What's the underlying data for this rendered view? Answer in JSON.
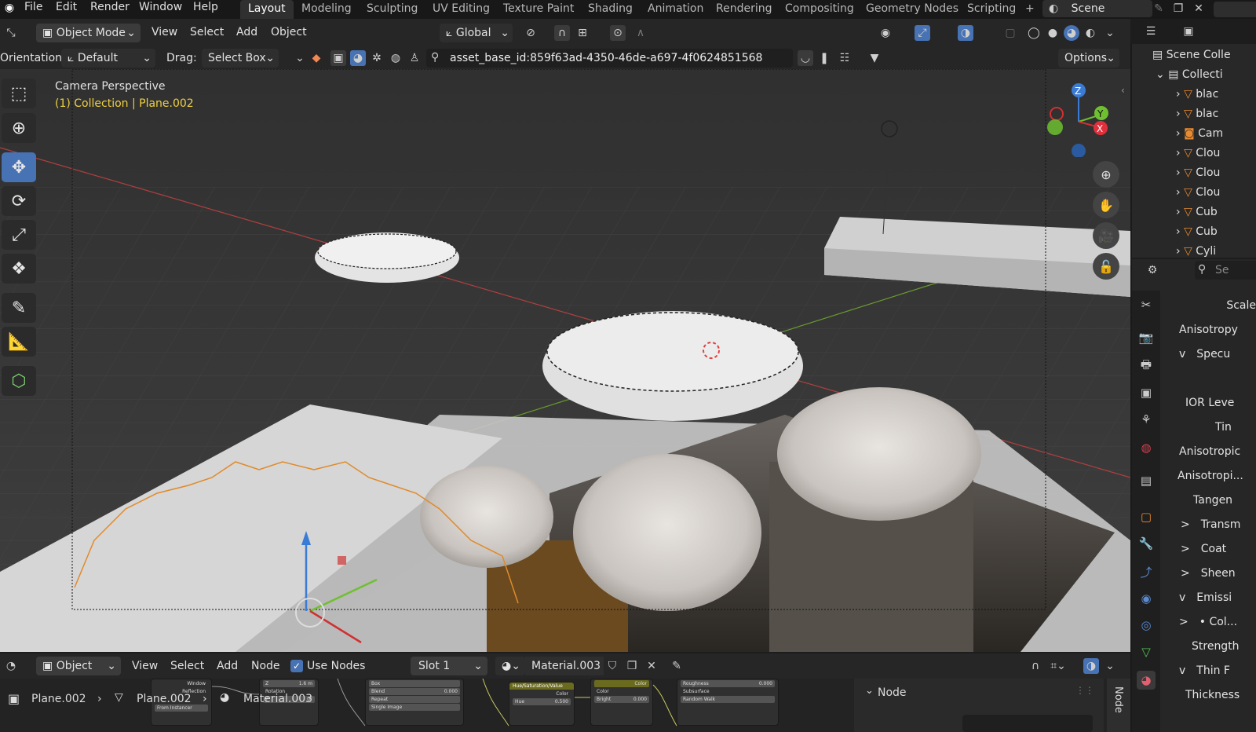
{
  "menu": {
    "items": [
      "File",
      "Edit",
      "Render",
      "Window",
      "Help"
    ]
  },
  "workspaces": {
    "active": "Layout",
    "tabs": [
      "Modeling",
      "Sculpting",
      "UV Editing",
      "Texture Paint",
      "Shading",
      "Animation",
      "Rendering",
      "Compositing",
      "Geometry Nodes",
      "Scripting"
    ]
  },
  "scene": {
    "label": "Scene",
    "add": "+"
  },
  "viewport_header": {
    "mode": "Object Mode",
    "menus": [
      "View",
      "Select",
      "Add",
      "Object"
    ],
    "transform": "Global"
  },
  "tool_header": {
    "orientation_label": "Orientation:",
    "orientation_value": "Default",
    "drag_label": "Drag:",
    "drag_value": "Select Box",
    "search_value": "asset_base_id:859f63ad-4350-46de-a697-4f0624851568",
    "options": "Options"
  },
  "viewport": {
    "camera_title": "Camera Perspective",
    "collection_info": "(1) Collection | Plane.002"
  },
  "gizmo": {
    "z": "Z",
    "y": "Y",
    "x": "X"
  },
  "outliner": {
    "scene_collection": "Scene Colle",
    "collection": "Collecti",
    "items": [
      {
        "label": "blac",
        "icon": "mesh-icon"
      },
      {
        "label": "blac",
        "icon": "mesh-icon"
      },
      {
        "label": "Cam",
        "icon": "camera-icon"
      },
      {
        "label": "Clou",
        "icon": "mesh-icon"
      },
      {
        "label": "Clou",
        "icon": "mesh-icon"
      },
      {
        "label": "Clou",
        "icon": "mesh-icon"
      },
      {
        "label": "Cub",
        "icon": "mesh-icon"
      },
      {
        "label": "Cub",
        "icon": "mesh-icon"
      },
      {
        "label": "Cyli",
        "icon": "mesh-icon"
      }
    ]
  },
  "properties": {
    "search_placeholder": "Se",
    "rows": [
      {
        "label": "Scale",
        "arrow": ""
      },
      {
        "label": "Anisotropy",
        "arrow": ""
      },
      {
        "label": "Specu",
        "arrow": "v"
      },
      {
        "label": "IOR Leve",
        "arrow": ""
      },
      {
        "label": "Tin",
        "arrow": ""
      },
      {
        "label": "Anisotropic",
        "arrow": ""
      },
      {
        "label": "Anisotropi...",
        "arrow": ""
      },
      {
        "label": "Tangen",
        "arrow": ""
      },
      {
        "label": "Transm",
        "arrow": ">"
      },
      {
        "label": "Coat",
        "arrow": ">"
      },
      {
        "label": "Sheen",
        "arrow": ">"
      },
      {
        "label": "Emissi",
        "arrow": "v"
      },
      {
        "label": "• Col...",
        "arrow": ">"
      },
      {
        "label": "Strength",
        "arrow": ""
      },
      {
        "label": "Thin F",
        "arrow": "v"
      },
      {
        "label": "Thickness",
        "arrow": ""
      }
    ]
  },
  "node_header": {
    "editor_type": "Object",
    "menus": [
      "View",
      "Select",
      "Add",
      "Node"
    ],
    "use_nodes": "Use Nodes",
    "slot": "Slot 1",
    "material": "Material.003"
  },
  "breadcrumb": {
    "object": "Plane.002",
    "mesh": "Plane.002",
    "material": "Material.003"
  },
  "node_panel": {
    "title": "Node"
  },
  "node_sidebar_tab": "Node",
  "nodes": {
    "n1": [
      "Window",
      "Reflection",
      "From Instancer"
    ],
    "n2": [
      "Z",
      "1.6 m",
      "Rotation",
      "Y",
      "0°"
    ],
    "n3": [
      "Box",
      "Blend",
      "0.000",
      "Repeat",
      "Single Image"
    ],
    "n4": [
      "Hue/Saturation/Value",
      "Color",
      "Hue",
      "0.500"
    ],
    "n5": [
      "Color",
      "Bright",
      "0.000",
      "Color"
    ],
    "n6": [
      "Roughness",
      "0.000",
      "Subsurface",
      "Random Walk"
    ]
  }
}
